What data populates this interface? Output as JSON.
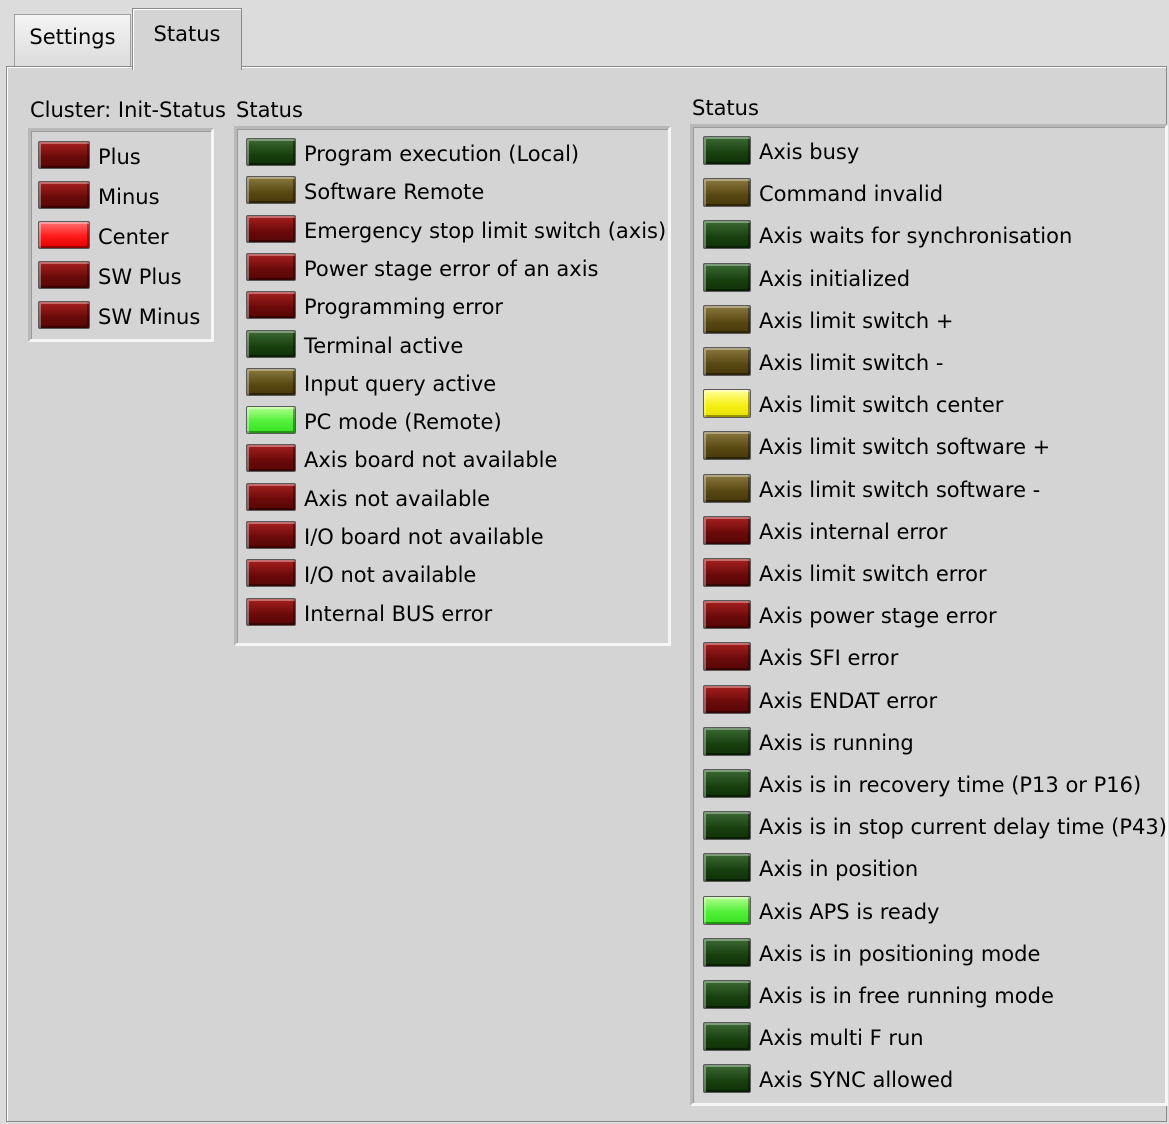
{
  "tabs": [
    {
      "label": "Settings",
      "active": false
    },
    {
      "label": "Status",
      "active": true
    }
  ],
  "init_status": {
    "title": "Cluster: Init-Status",
    "items": [
      {
        "label": "Plus",
        "state": "red"
      },
      {
        "label": "Minus",
        "state": "red"
      },
      {
        "label": "Center",
        "state": "brightred"
      },
      {
        "label": "SW Plus",
        "state": "red"
      },
      {
        "label": "SW Minus",
        "state": "red"
      }
    ]
  },
  "status_general": {
    "title": "Status",
    "items": [
      {
        "label": "Program execution (Local)",
        "state": "green"
      },
      {
        "label": "Software Remote",
        "state": "olive"
      },
      {
        "label": "Emergency stop limit switch (axis)",
        "state": "red"
      },
      {
        "label": "Power stage error of an axis",
        "state": "red"
      },
      {
        "label": "Programming error",
        "state": "red"
      },
      {
        "label": "Terminal active",
        "state": "green"
      },
      {
        "label": "Input query active",
        "state": "olive"
      },
      {
        "label": "PC mode (Remote)",
        "state": "brightgreen"
      },
      {
        "label": "Axis board not available",
        "state": "red"
      },
      {
        "label": "Axis not available",
        "state": "red"
      },
      {
        "label": "I/O board not available",
        "state": "red"
      },
      {
        "label": "I/O not available",
        "state": "red"
      },
      {
        "label": "Internal BUS error",
        "state": "red"
      }
    ]
  },
  "status_axis": {
    "title": "Status",
    "items": [
      {
        "label": "Axis busy",
        "state": "green"
      },
      {
        "label": "Command invalid",
        "state": "olive"
      },
      {
        "label": "Axis waits for synchronisation",
        "state": "green"
      },
      {
        "label": "Axis initialized",
        "state": "green"
      },
      {
        "label": "Axis limit switch +",
        "state": "olive"
      },
      {
        "label": "Axis limit switch -",
        "state": "olive"
      },
      {
        "label": "Axis limit switch center",
        "state": "yellow"
      },
      {
        "label": "Axis limit switch software +",
        "state": "olive"
      },
      {
        "label": "Axis limit switch software -",
        "state": "olive"
      },
      {
        "label": "Axis internal error",
        "state": "red"
      },
      {
        "label": "Axis limit switch error",
        "state": "red"
      },
      {
        "label": "Axis power stage error",
        "state": "red"
      },
      {
        "label": "Axis SFI error",
        "state": "red"
      },
      {
        "label": "Axis ENDAT error",
        "state": "red"
      },
      {
        "label": "Axis is running",
        "state": "green"
      },
      {
        "label": "Axis is in recovery time (P13 or P16)",
        "state": "green"
      },
      {
        "label": "Axis is in stop current delay time (P43)",
        "state": "green"
      },
      {
        "label": "Axis in position",
        "state": "green"
      },
      {
        "label": "Axis APS is ready",
        "state": "brightgreen"
      },
      {
        "label": "Axis is in positioning mode",
        "state": "green"
      },
      {
        "label": "Axis is in free running mode",
        "state": "green"
      },
      {
        "label": "Axis multi F run",
        "state": "green"
      },
      {
        "label": "Axis SYNC allowed",
        "state": "green"
      }
    ]
  }
}
